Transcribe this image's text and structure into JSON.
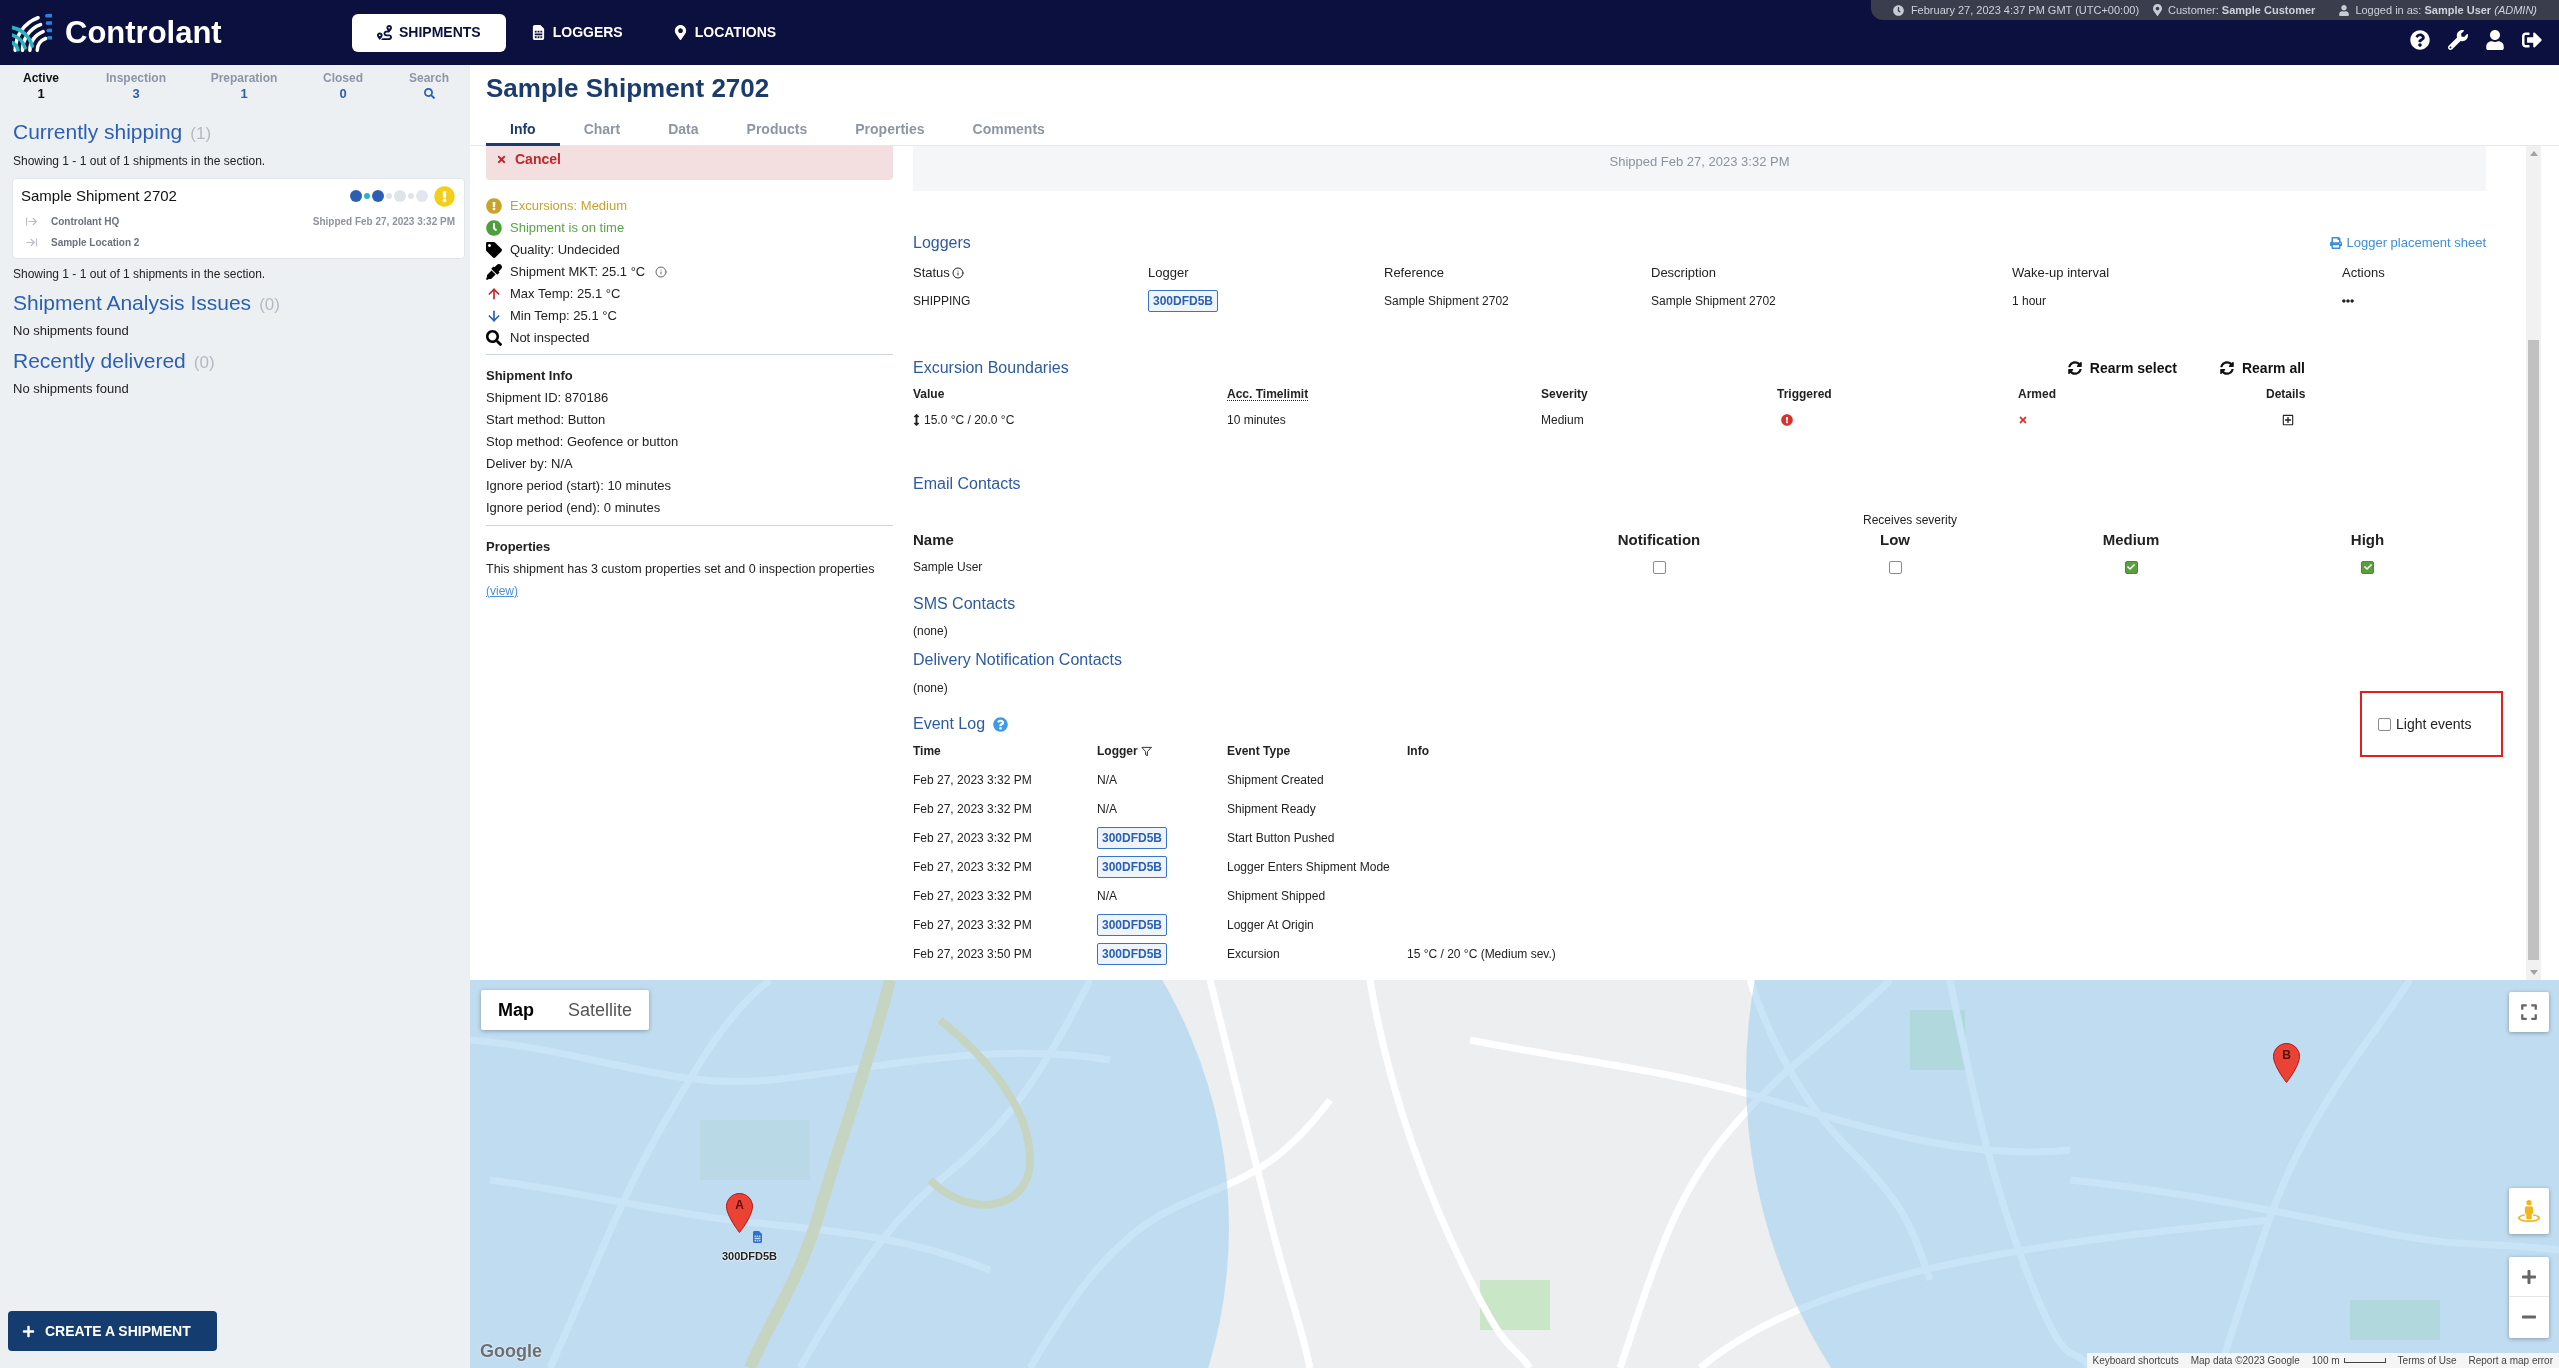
{
  "header": {
    "logo": "Controlant",
    "nav": [
      {
        "label": "SHIPMENTS",
        "selected": true
      },
      {
        "label": "LOGGERS",
        "selected": false
      },
      {
        "label": "LOCATIONS",
        "selected": false
      }
    ],
    "info_bar": {
      "datetime": "February 27, 2023 4:37 PM GMT (UTC+00:00)",
      "customer": "Customer: **Sample Customer**",
      "user": "Logged in as: **Sample User** *(ADMIN)*"
    }
  },
  "sidebar": {
    "tabs": [
      {
        "label": "Active",
        "count": "1",
        "selected": true
      },
      {
        "label": "Inspection",
        "count": "3",
        "selected": false
      },
      {
        "label": "Preparation",
        "count": "1",
        "selected": false
      },
      {
        "label": "Closed",
        "count": "0",
        "selected": false
      },
      {
        "label": "Search",
        "selected": false
      }
    ],
    "sections": [
      {
        "title": "Currently shipping",
        "count": "(1)",
        "summary_top": "Showing 1 - 1 out of 1 shipments in the section.",
        "shipments": [
          {
            "name": "Sample Shipment 2702",
            "origin": "Controlant HQ",
            "destination": "Sample Location 2",
            "shipped": "Shipped Feb 27, 2023 3:32 PM"
          }
        ],
        "summary_bottom": "Showing 1 - 1 out of 1 shipments in the section."
      },
      {
        "title": "Shipment Analysis Issues",
        "count": "(0)",
        "empty": "No shipments found"
      },
      {
        "title": "Recently delivered",
        "count": "(0)",
        "empty": "No shipments found"
      }
    ],
    "create_button": "CREATE A SHIPMENT"
  },
  "shipment": {
    "title": "Sample Shipment 2702",
    "tabs": [
      {
        "label": "Info",
        "selected": true
      },
      {
        "label": "Chart",
        "selected": false
      },
      {
        "label": "Data",
        "selected": false
      },
      {
        "label": "Products",
        "selected": false
      },
      {
        "label": "Properties",
        "selected": false
      },
      {
        "label": "Comments",
        "selected": false
      }
    ]
  },
  "info_panel": {
    "cancel": "Cancel",
    "status": [
      {
        "kind": "excursion",
        "text": "Excursions: Medium"
      },
      {
        "kind": "timing",
        "text": "Shipment is on time"
      },
      {
        "kind": "quality",
        "text": "Quality: Undecided"
      },
      {
        "kind": "mkt",
        "text": "Shipment MKT: 25.1 °C"
      },
      {
        "kind": "max",
        "text": "Max Temp: 25.1 °C"
      },
      {
        "kind": "min",
        "text": "Min Temp: 25.1 °C"
      },
      {
        "kind": "inspection",
        "text": "Not inspected"
      }
    ],
    "shipment_info": {
      "title": "Shipment Info",
      "lines": [
        "Shipment ID: 870186",
        "Start method: Button",
        "Stop method: Geofence or button",
        "Deliver by: N/A",
        "Ignore period (start): 10 minutes",
        "Ignore period (end): 0 minutes"
      ]
    },
    "properties": {
      "title": "Properties",
      "text": "This shipment has 3 custom properties set and 0 inspection properties",
      "link": "(view)"
    }
  },
  "shipped_banner": "Shipped Feb 27, 2023 3:32 PM",
  "loggers": {
    "title": "Loggers",
    "placement_link": "Logger placement sheet",
    "columns": [
      "Status",
      "Logger",
      "Reference",
      "Description",
      "Wake-up interval",
      "Actions"
    ],
    "rows": [
      {
        "status": "SHIPPING",
        "logger": "300DFD5B",
        "reference": "Sample Shipment 2702",
        "description": "Sample Shipment 2702",
        "wake_up_interval": "1 hour"
      }
    ]
  },
  "excursion_boundaries": {
    "title": "Excursion Boundaries",
    "actions": [
      "Rearm select",
      "Rearm all"
    ],
    "columns": [
      "Value",
      "Acc. Timelimit",
      "Severity",
      "Triggered",
      "Armed",
      "Details"
    ],
    "rows": [
      {
        "value": "15.0 °C / 20.0 °C",
        "timelimit": "10 minutes",
        "severity": "Medium",
        "triggered": true,
        "armed": false
      }
    ]
  },
  "email_contacts": {
    "title": "Email Contacts",
    "group_label": "Receives severity",
    "columns": [
      "Name",
      "Notification",
      "Low",
      "Medium",
      "High"
    ],
    "rows": [
      {
        "name": "Sample User",
        "options": [
          {
            "checked": false
          },
          {
            "checked": false
          },
          {
            "checked": true
          },
          {
            "checked": true
          }
        ]
      }
    ]
  },
  "sms_contacts": {
    "title": "SMS Contacts",
    "empty": "(none)"
  },
  "delivery_contacts": {
    "title": "Delivery Notification Contacts",
    "empty": "(none)"
  },
  "event_log": {
    "title": "Event Log",
    "light_events": {
      "label": "Light events",
      "checked": false,
      "highlighted": true
    },
    "columns": [
      "Time",
      "Logger",
      "Event Type",
      "Info"
    ],
    "rows": [
      {
        "time": "Feb 27, 2023 3:32 PM",
        "logger": {
          "kind": "text",
          "label": "N/A"
        },
        "event": "Shipment Created"
      },
      {
        "time": "Feb 27, 2023 3:32 PM",
        "logger": {
          "kind": "text",
          "label": "N/A"
        },
        "event": "Shipment Ready"
      },
      {
        "time": "Feb 27, 2023 3:32 PM",
        "logger": {
          "kind": "badge",
          "label": "300DFD5B"
        },
        "event": "Start Button Pushed"
      },
      {
        "time": "Feb 27, 2023 3:32 PM",
        "logger": {
          "kind": "badge",
          "label": "300DFD5B"
        },
        "event": "Logger Enters Shipment Mode"
      },
      {
        "time": "Feb 27, 2023 3:32 PM",
        "logger": {
          "kind": "text",
          "label": "N/A"
        },
        "event": "Shipment Shipped"
      },
      {
        "time": "Feb 27, 2023 3:32 PM",
        "logger": {
          "kind": "badge",
          "label": "300DFD5B"
        },
        "event": "Logger At Origin"
      },
      {
        "time": "Feb 27, 2023 3:50 PM",
        "logger": {
          "kind": "badge",
          "label": "300DFD5B"
        },
        "event": "Excursion",
        "info": "15 °C / 20 °C (Medium sev.)"
      }
    ]
  },
  "map": {
    "map_types": [
      {
        "label": "Map",
        "selected": true
      },
      {
        "label": "Satellite",
        "selected": false
      }
    ],
    "markers": [
      {
        "label": "A",
        "caption": "300DFD5B"
      },
      {
        "label": "B"
      }
    ],
    "logo": "Google",
    "footer": [
      {
        "kind": "link",
        "text": "Keyboard shortcuts"
      },
      {
        "kind": "text",
        "text": "Map data ©2023 Google"
      },
      {
        "kind": "scale",
        "text": "100 m"
      },
      {
        "kind": "link",
        "text": "Terms of Use"
      },
      {
        "kind": "link",
        "text": "Report a map error"
      }
    ]
  }
}
